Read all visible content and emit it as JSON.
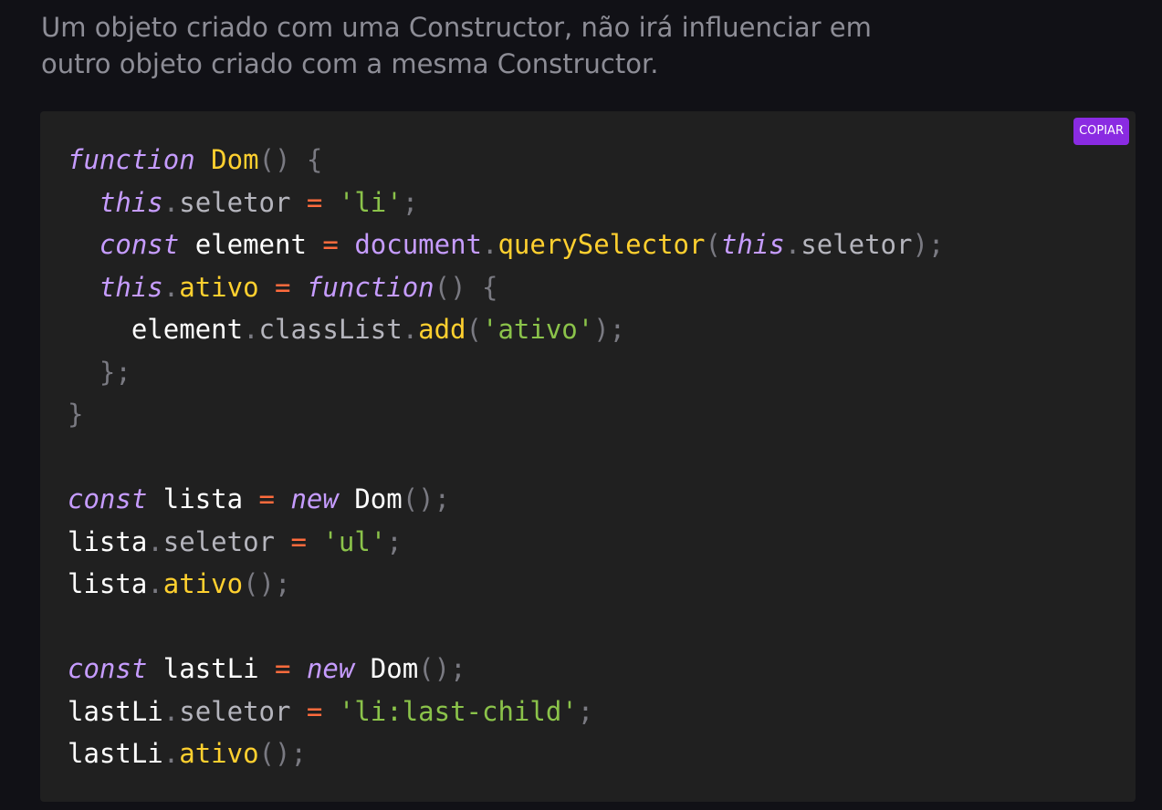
{
  "intro": {
    "line1": "Um objeto criado com uma Constructor, não irá influenciar em",
    "line2": "outro objeto criado com a mesma Constructor."
  },
  "copy_button": {
    "label": "COPIAR"
  },
  "code_lines": [
    [
      [
        "kw",
        "function"
      ],
      [
        "var",
        " "
      ],
      [
        "fn",
        "Dom"
      ],
      [
        "punc",
        "() {"
      ]
    ],
    [
      [
        "var",
        "  "
      ],
      [
        "kw",
        "this"
      ],
      [
        "punc",
        "."
      ],
      [
        "prop",
        "seletor"
      ],
      [
        "var",
        " "
      ],
      [
        "op",
        "="
      ],
      [
        "var",
        " "
      ],
      [
        "str",
        "'li'"
      ],
      [
        "punc",
        ";"
      ]
    ],
    [
      [
        "var",
        "  "
      ],
      [
        "kw",
        "const"
      ],
      [
        "var",
        " element "
      ],
      [
        "op",
        "="
      ],
      [
        "var",
        " "
      ],
      [
        "kw-plain",
        "document"
      ],
      [
        "punc",
        "."
      ],
      [
        "fn",
        "querySelector"
      ],
      [
        "punc",
        "("
      ],
      [
        "kw",
        "this"
      ],
      [
        "punc",
        "."
      ],
      [
        "prop",
        "seletor"
      ],
      [
        "punc",
        ");"
      ]
    ],
    [
      [
        "var",
        "  "
      ],
      [
        "kw",
        "this"
      ],
      [
        "punc",
        "."
      ],
      [
        "fn",
        "ativo"
      ],
      [
        "var",
        " "
      ],
      [
        "op",
        "="
      ],
      [
        "var",
        " "
      ],
      [
        "kw",
        "function"
      ],
      [
        "punc",
        "() {"
      ]
    ],
    [
      [
        "var",
        "    element"
      ],
      [
        "punc",
        "."
      ],
      [
        "prop",
        "classList"
      ],
      [
        "punc",
        "."
      ],
      [
        "fn",
        "add"
      ],
      [
        "punc",
        "("
      ],
      [
        "str",
        "'ativo'"
      ],
      [
        "punc",
        ");"
      ]
    ],
    [
      [
        "var",
        "  "
      ],
      [
        "punc",
        "};"
      ]
    ],
    [
      [
        "punc",
        "}"
      ]
    ],
    [],
    [
      [
        "kw",
        "const"
      ],
      [
        "var",
        " lista "
      ],
      [
        "op",
        "="
      ],
      [
        "var",
        " "
      ],
      [
        "kw",
        "new"
      ],
      [
        "var",
        " Dom"
      ],
      [
        "punc",
        "();"
      ]
    ],
    [
      [
        "var",
        "lista"
      ],
      [
        "punc",
        "."
      ],
      [
        "prop",
        "seletor"
      ],
      [
        "var",
        " "
      ],
      [
        "op",
        "="
      ],
      [
        "var",
        " "
      ],
      [
        "str",
        "'ul'"
      ],
      [
        "punc",
        ";"
      ]
    ],
    [
      [
        "var",
        "lista"
      ],
      [
        "punc",
        "."
      ],
      [
        "fn",
        "ativo"
      ],
      [
        "punc",
        "();"
      ]
    ],
    [],
    [
      [
        "kw",
        "const"
      ],
      [
        "var",
        " lastLi "
      ],
      [
        "op",
        "="
      ],
      [
        "var",
        " "
      ],
      [
        "kw",
        "new"
      ],
      [
        "var",
        " Dom"
      ],
      [
        "punc",
        "();"
      ]
    ],
    [
      [
        "var",
        "lastLi"
      ],
      [
        "punc",
        "."
      ],
      [
        "prop",
        "seletor"
      ],
      [
        "var",
        " "
      ],
      [
        "op",
        "="
      ],
      [
        "var",
        " "
      ],
      [
        "str",
        "'li:last-child'"
      ],
      [
        "punc",
        ";"
      ]
    ],
    [
      [
        "var",
        "lastLi"
      ],
      [
        "punc",
        "."
      ],
      [
        "fn",
        "ativo"
      ],
      [
        "punc",
        "();"
      ]
    ]
  ],
  "colors": {
    "page_background": "#111116",
    "code_background": "#202020",
    "keyword": "#c69cff",
    "function": "#ffd02f",
    "string": "#8bc34a",
    "operator": "#ff6b3d",
    "punctuation": "#7a7a82",
    "property": "#b5b5bd",
    "copy_button": "#8a2be2"
  }
}
